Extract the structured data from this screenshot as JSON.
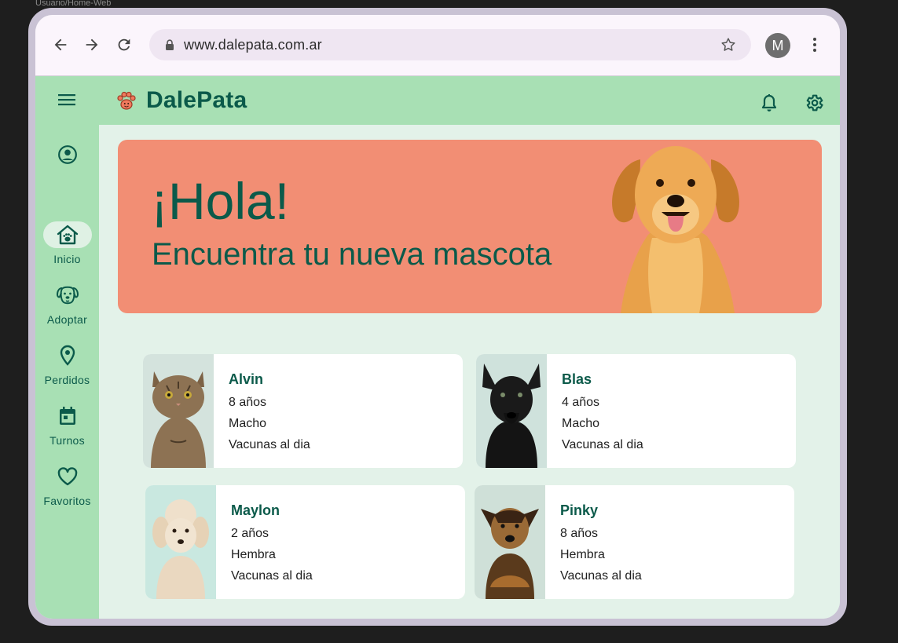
{
  "frame_label": "Usuario/Home-Web",
  "browser": {
    "url": "www.dalepata.com.ar",
    "account_initial": "M"
  },
  "app": {
    "brand": "DalePata",
    "nav": [
      {
        "label": "Inicio",
        "icon": "home-paw-icon",
        "active": true
      },
      {
        "label": "Adoptar",
        "icon": "dog-face-icon",
        "active": false
      },
      {
        "label": "Perdidos",
        "icon": "location-pin-icon",
        "active": false
      },
      {
        "label": "Turnos",
        "icon": "calendar-icon",
        "active": false
      },
      {
        "label": "Favoritos",
        "icon": "heart-icon",
        "active": false
      }
    ]
  },
  "hero": {
    "title": "¡Hola!",
    "subtitle": "Encuentra tu nueva mascota"
  },
  "pets": [
    {
      "name": "Alvin",
      "age": "8 años",
      "sex": "Macho",
      "vaccines": "Vacunas al dia"
    },
    {
      "name": "Blas",
      "age": "4 años",
      "sex": "Macho",
      "vaccines": "Vacunas al dia"
    },
    {
      "name": "Maylon",
      "age": "2 años",
      "sex": "Hembra",
      "vaccines": "Vacunas al dia"
    },
    {
      "name": "Pinky",
      "age": "8 años",
      "sex": "Hembra",
      "vaccines": "Vacunas al dia"
    }
  ],
  "colors": {
    "accent": "#0b5a4a",
    "nav_bg": "#a8e0b4",
    "hero_bg": "#f28e74",
    "page_bg": "#e3f2e9"
  }
}
